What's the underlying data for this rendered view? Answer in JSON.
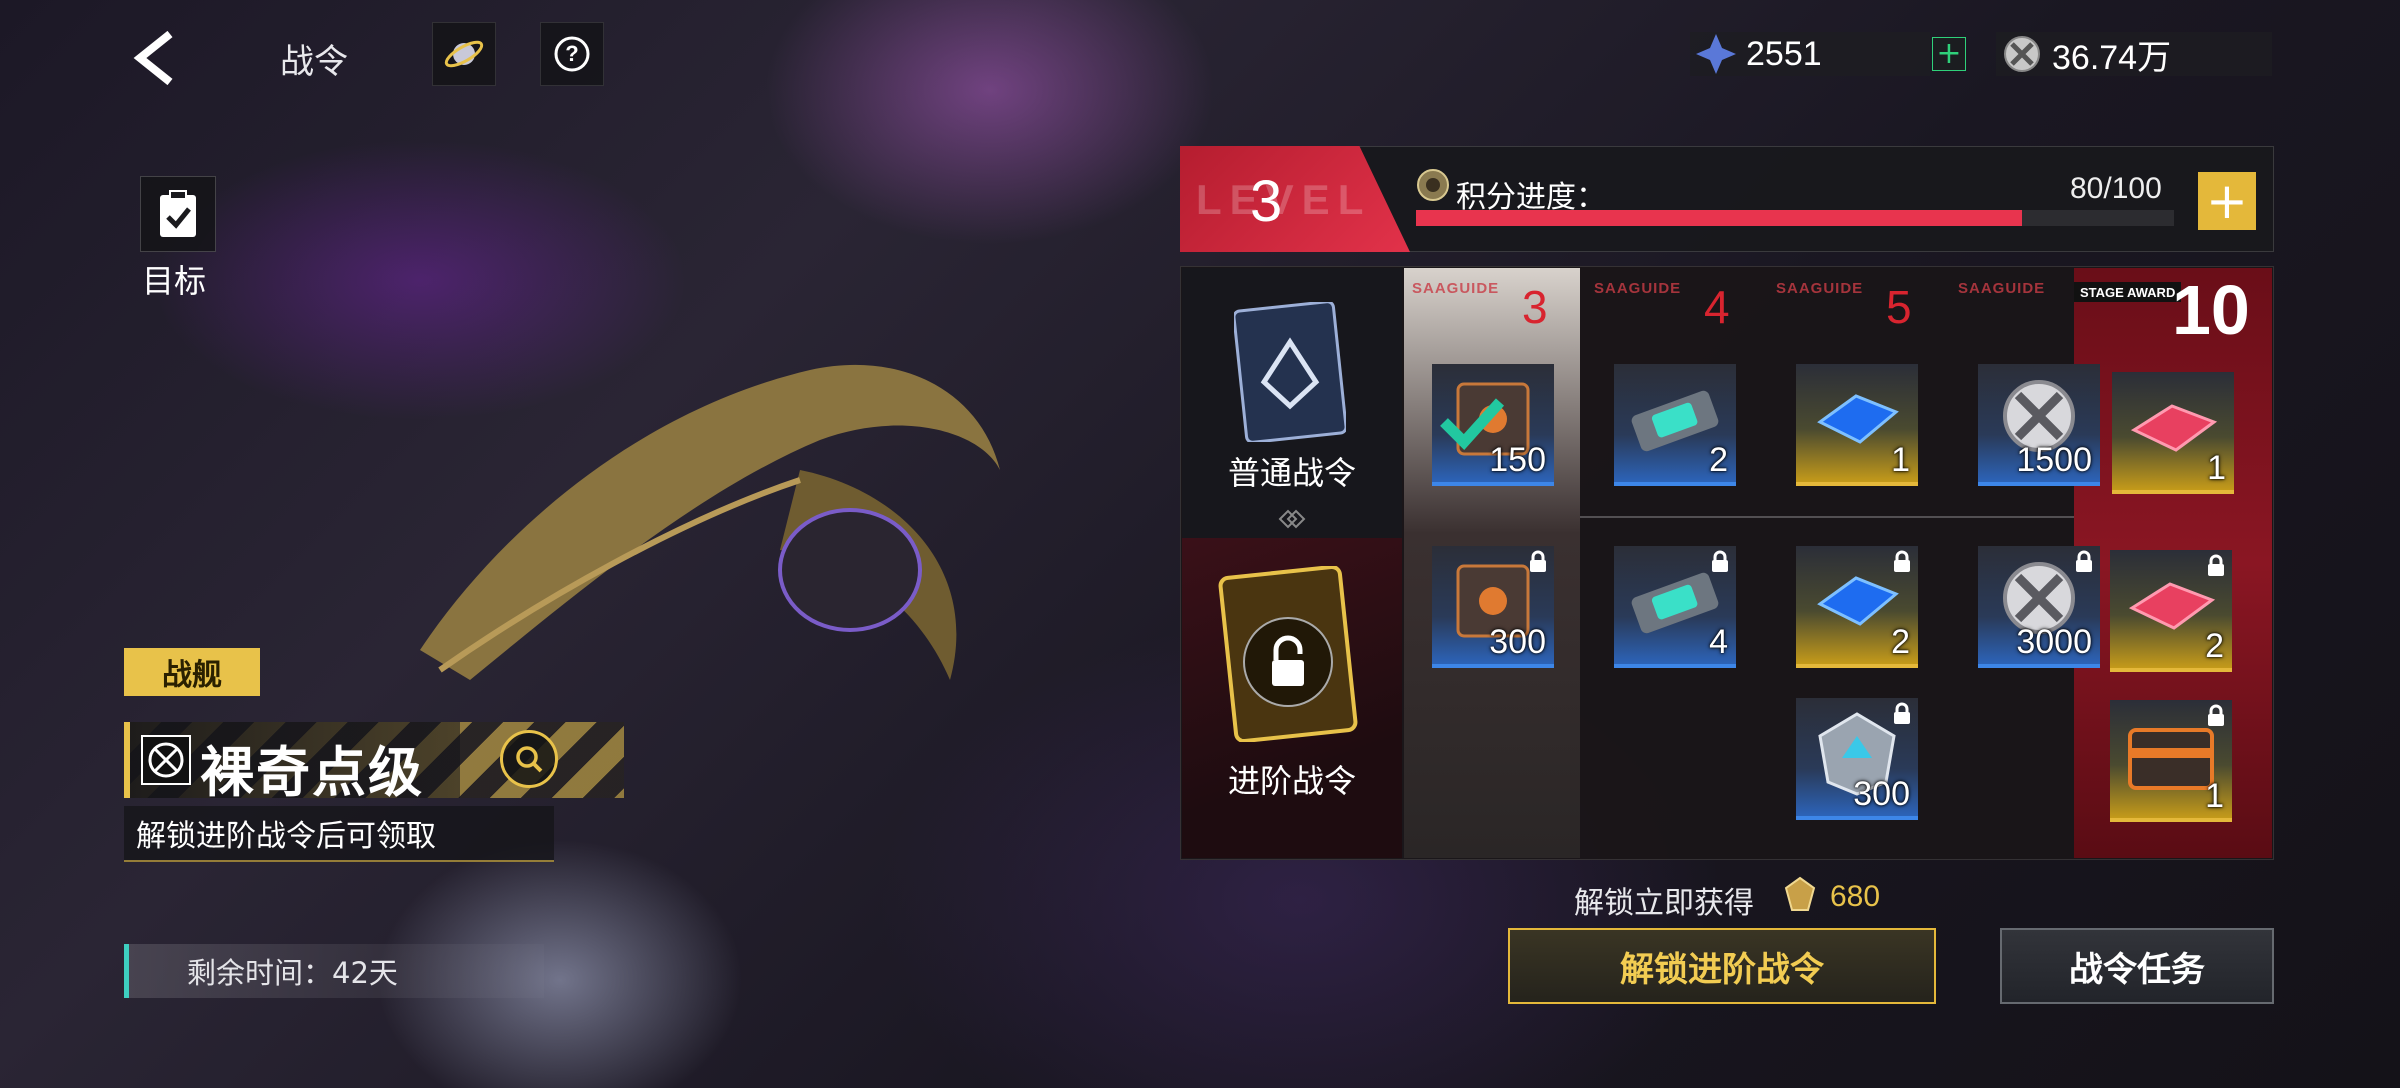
{
  "header": {
    "title": "战令",
    "currency_crystal": "2551",
    "currency_coin": "36.74万"
  },
  "target": {
    "label": "目标"
  },
  "ship": {
    "tag": "战舰",
    "name": "裸奇点级",
    "unlock_hint": "解锁进阶战令后可领取",
    "remaining": "剩余时间：42天"
  },
  "level": {
    "bg_text": "LEVEL",
    "current": "3",
    "points_label": "积分进度：",
    "points_value": "80/100",
    "progress": 0.8
  },
  "passes": {
    "normal": "普通战令",
    "advanced": "进阶战令"
  },
  "columns": [
    {
      "level": "3",
      "tag": "SAAGUIDE"
    },
    {
      "level": "4",
      "tag": "SAAGUIDE"
    },
    {
      "level": "5",
      "tag": "SAAGUIDE"
    },
    {
      "level": "",
      "tag": "SAAGUIDE"
    }
  ],
  "stage_award": {
    "tag": "STAGE AWARD",
    "level": "10"
  },
  "normal_rewards": [
    {
      "qty": "150",
      "icon": "supply-crate-icon",
      "rarity": "blue",
      "claimed": true
    },
    {
      "qty": "2",
      "icon": "blueprint-module-icon",
      "rarity": "blue"
    },
    {
      "qty": "1",
      "icon": "blue-chip-icon",
      "rarity": "gold"
    },
    {
      "qty": "1500",
      "icon": "coin-icon",
      "rarity": "blue"
    },
    {
      "qty": "1",
      "icon": "red-chip-icon",
      "rarity": "gold"
    }
  ],
  "advanced_rewards": [
    {
      "qty": "300",
      "icon": "supply-crate-icon",
      "rarity": "blue"
    },
    {
      "qty": "4",
      "icon": "blueprint-module-icon",
      "rarity": "blue"
    },
    {
      "qty": "2",
      "icon": "blue-chip-icon",
      "rarity": "gold"
    },
    {
      "qty": "3000",
      "icon": "coin-icon",
      "rarity": "blue"
    },
    {
      "qty": "2",
      "icon": "red-chip-icon",
      "rarity": "gold"
    }
  ],
  "extra_rewards": [
    {
      "qty": "300",
      "icon": "alloy-core-icon",
      "rarity": "blue"
    },
    {
      "qty": "1",
      "icon": "orange-chest-icon",
      "rarity": "gold"
    }
  ],
  "footer": {
    "unlock_gain": "解锁立即获得",
    "gain_value": "680",
    "unlock_button": "解锁进阶战令",
    "task_button": "战令任务"
  },
  "colors": {
    "accent_gold": "#e4b83a",
    "accent_red": "#e8344e",
    "accent_teal": "#3ecfc0"
  }
}
